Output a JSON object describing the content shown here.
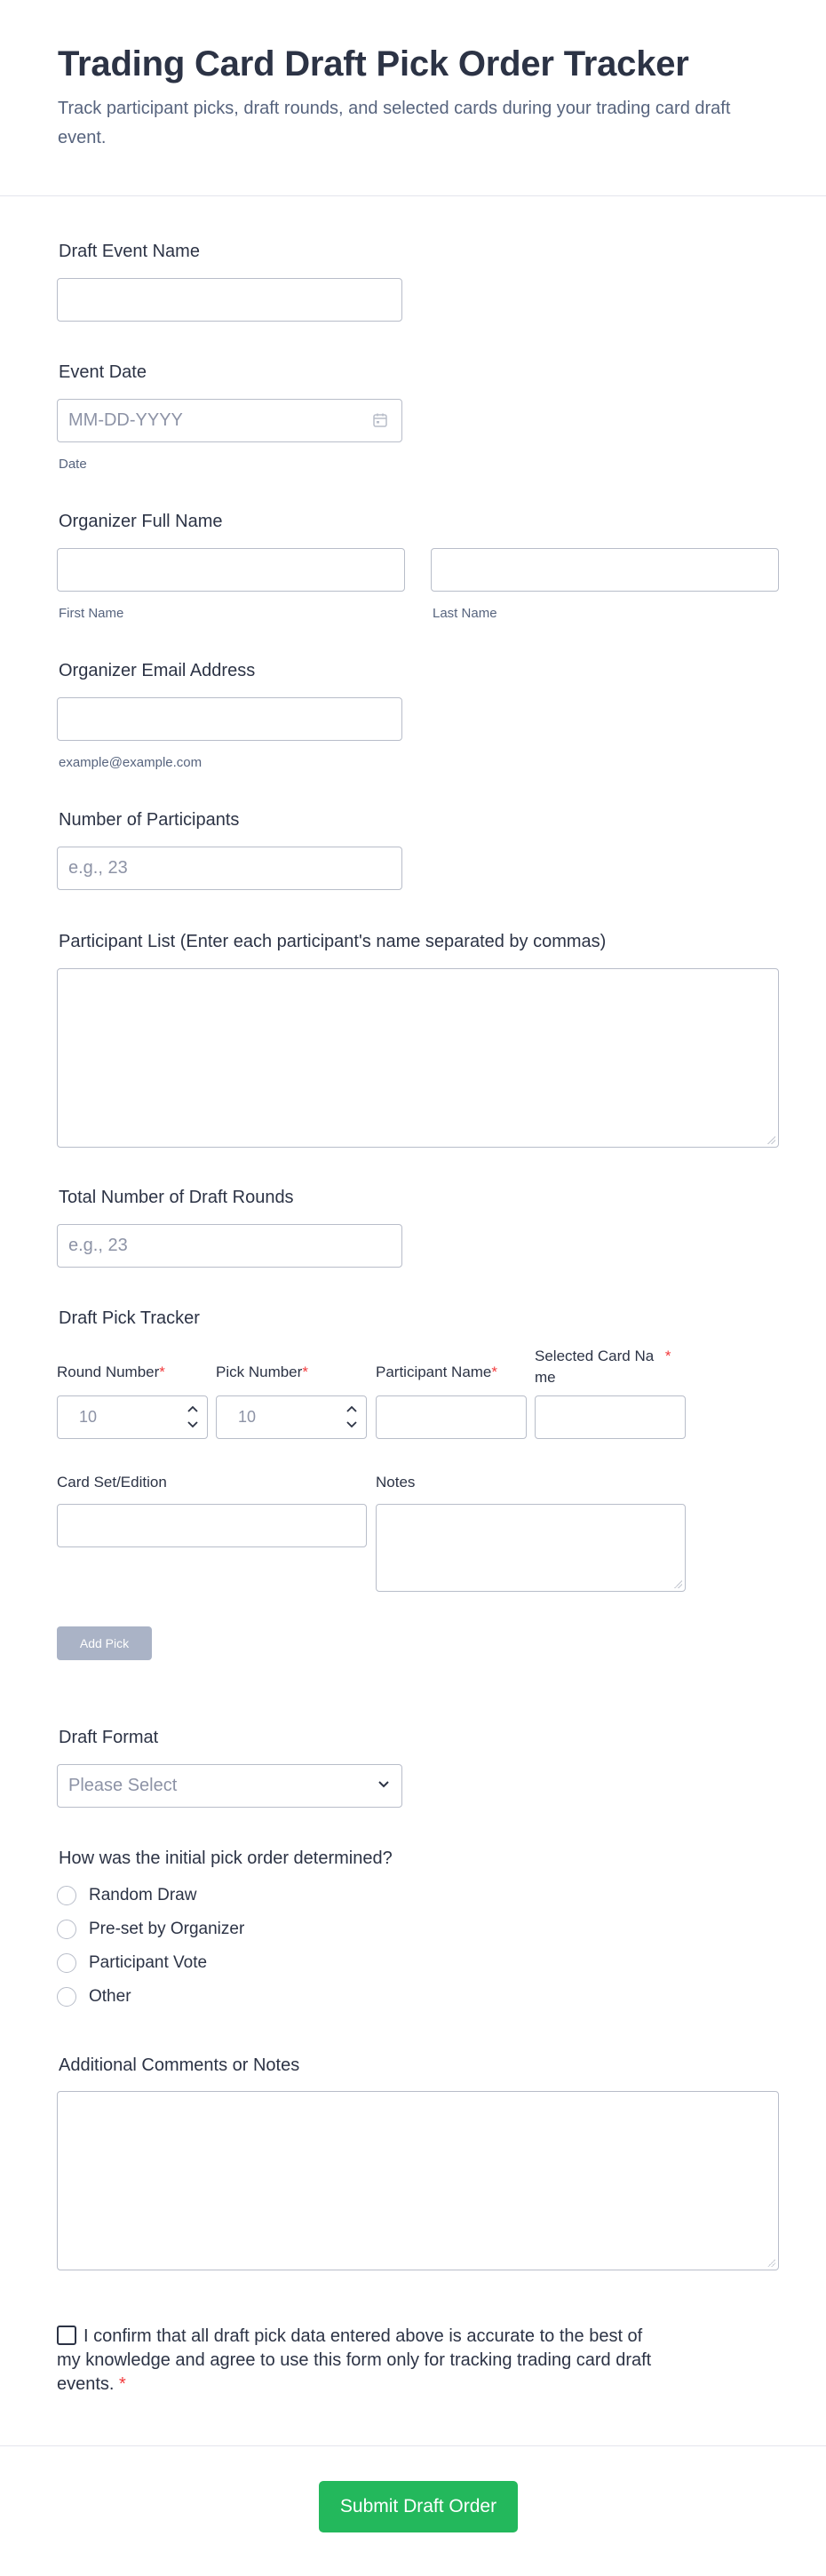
{
  "header": {
    "title": "Trading Card Draft Pick Order Tracker",
    "subtitle": "Track participant picks, draft rounds, and selected cards during your trading card draft event."
  },
  "fields": {
    "event_name": {
      "label": "Draft Event Name",
      "value": ""
    },
    "event_date": {
      "label": "Event Date",
      "placeholder": "MM-DD-YYYY",
      "sublabel": "Date"
    },
    "organizer_name": {
      "label": "Organizer Full Name",
      "first_sublabel": "First Name",
      "last_sublabel": "Last Name"
    },
    "organizer_email": {
      "label": "Organizer Email Address",
      "sublabel": "example@example.com"
    },
    "num_participants": {
      "label": "Number of Participants",
      "placeholder": "e.g., 23"
    },
    "participant_list": {
      "label": "Participant List (Enter each participant's name separated by commas)"
    },
    "total_rounds": {
      "label": "Total Number of Draft Rounds",
      "placeholder": "e.g., 23"
    }
  },
  "pick_tracker": {
    "label": "Draft Pick Tracker",
    "round_number": {
      "label": "Round Number",
      "placeholder": "10"
    },
    "pick_number": {
      "label": "Pick Number",
      "placeholder": "10"
    },
    "participant_name": {
      "label": "Participant Name"
    },
    "selected_card_line1": "Selected Card Na",
    "selected_card_line2": "me",
    "card_set": {
      "label": "Card Set/Edition"
    },
    "notes": {
      "label": "Notes"
    },
    "add_button": "Add Pick",
    "required_mark": "*"
  },
  "draft_format": {
    "label": "Draft Format",
    "selected": "Please Select"
  },
  "pick_order": {
    "label": "How was the initial pick order determined?",
    "options": [
      "Random Draw",
      "Pre-set by Organizer",
      "Participant Vote",
      "Other"
    ]
  },
  "comments": {
    "label": "Additional Comments or Notes"
  },
  "confirm": {
    "line1": "I confirm that all draft pick data entered above is accurate to the best of",
    "line2": "my knowledge and agree to use this form only for tracking trading card draft",
    "line3": "events.",
    "required_mark": "*"
  },
  "submit": {
    "label": "Submit Draft Order",
    "color": "#23b85c"
  }
}
